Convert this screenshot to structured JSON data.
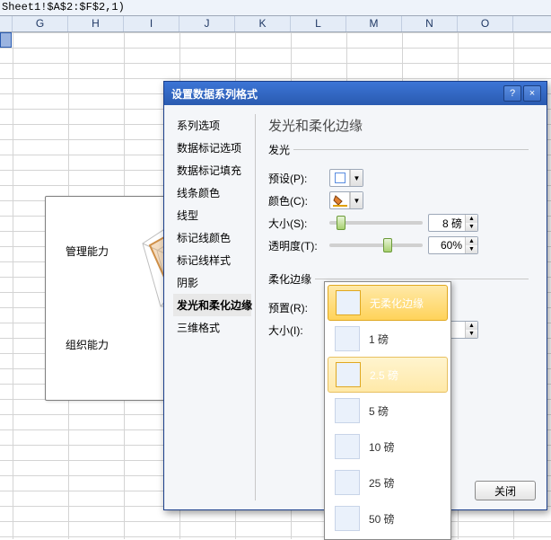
{
  "formula": "Sheet1!$A$2:$F$2,1)",
  "columns": [
    "G",
    "H",
    "I",
    "J",
    "K",
    "L",
    "M",
    "N",
    "O"
  ],
  "chart": {
    "label_mgmt": "管理能力",
    "label_org": "组织能力"
  },
  "dialog": {
    "title": "设置数据系列格式",
    "help": "?",
    "close_x": "×",
    "sidebar": [
      "系列选项",
      "数据标记选项",
      "数据标记填充",
      "线条颜色",
      "线型",
      "标记线颜色",
      "标记线样式",
      "阴影",
      "发光和柔化边缘",
      "三维格式"
    ],
    "pane_title": "发光和柔化边缘",
    "glow_legend": "发光",
    "glow_preset_label": "预设(P):",
    "glow_color_label": "颜色(C):",
    "glow_size_label": "大小(S):",
    "glow_size_value": "8 磅",
    "glow_trans_label": "透明度(T):",
    "glow_trans_value": "60%",
    "soft_legend": "柔化边缘",
    "soft_preset_label": "预置(R):",
    "soft_size_label": "大小(I):",
    "close_btn": "关闭"
  },
  "popup": {
    "options": [
      "无柔化边缘",
      "1 磅",
      "2.5 磅",
      "5 磅",
      "10 磅",
      "25 磅",
      "50 磅"
    ]
  }
}
